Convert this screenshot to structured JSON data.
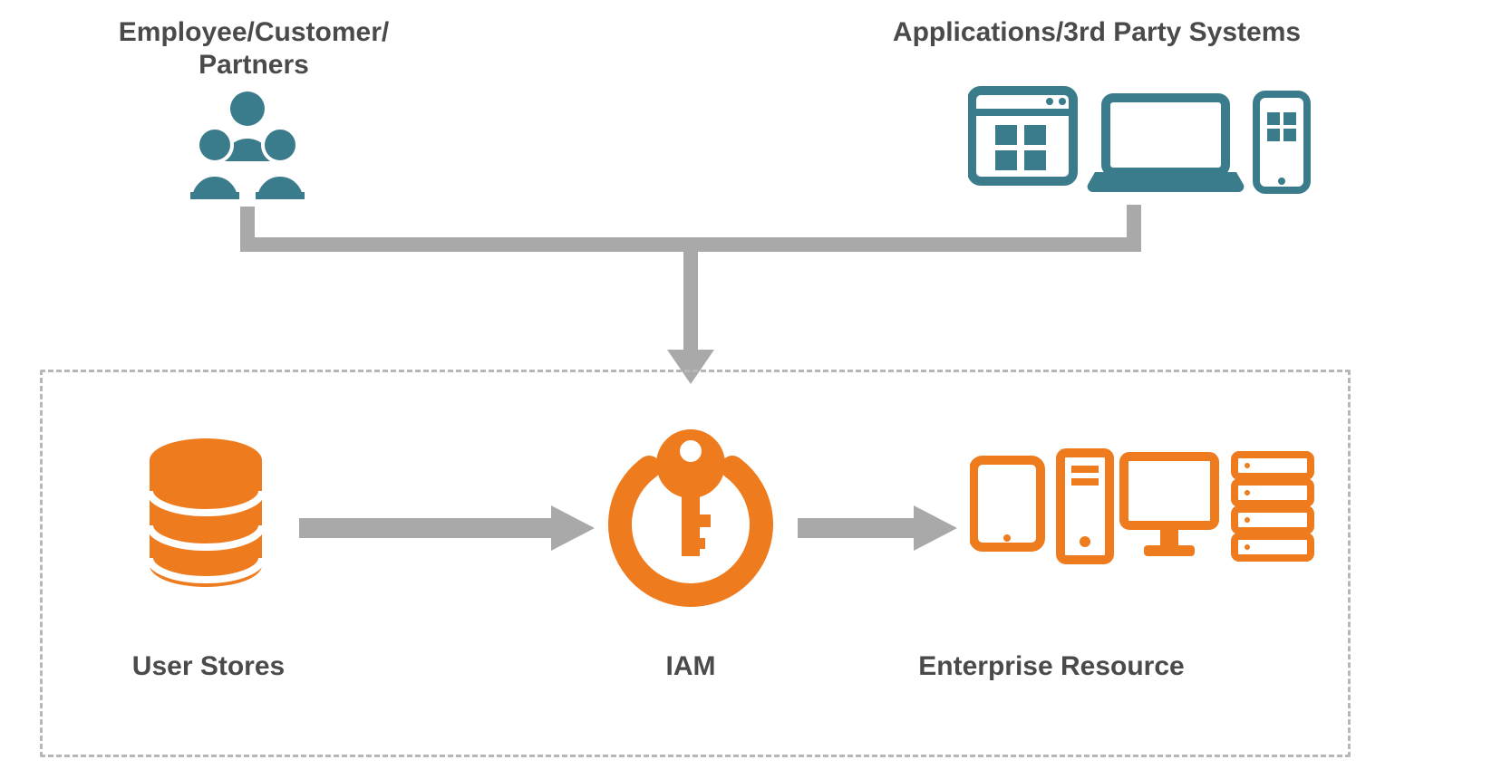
{
  "colors": {
    "teal": "#3a7c8c",
    "orange": "#ee7b1e",
    "gray_arrow": "#a9a9a9",
    "gray_text": "#4a4a4a",
    "dash": "#b7b7b7"
  },
  "nodes": {
    "top_left": {
      "label_line1": "Employee/Customer/",
      "label_line2": "Partners",
      "icon_name": "people-group-icon"
    },
    "top_right": {
      "label": "Applications/3rd Party Systems",
      "icon_name": "devices-icon"
    },
    "bottom_left": {
      "label": "User Stores",
      "icon_name": "database-icon"
    },
    "bottom_center": {
      "label": "IAM",
      "icon_name": "key-power-icon"
    },
    "bottom_right": {
      "label": "Enterprise Resource",
      "icon_name": "enterprise-devices-icon"
    }
  },
  "flows": [
    {
      "from": "top_left",
      "to": "bottom_center"
    },
    {
      "from": "top_right",
      "to": "bottom_center"
    },
    {
      "from": "bottom_left",
      "to": "bottom_center"
    },
    {
      "from": "bottom_center",
      "to": "bottom_right"
    }
  ]
}
